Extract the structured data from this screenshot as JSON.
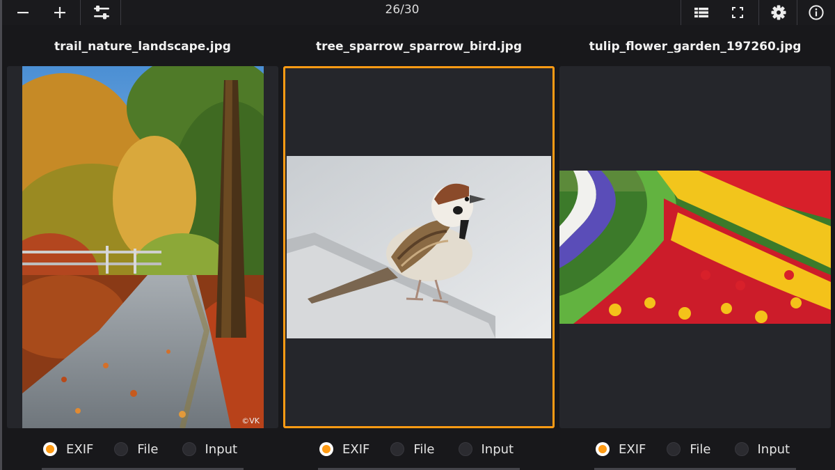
{
  "toolbar": {
    "counter": "26/30",
    "left_icons": [
      "minus-icon",
      "plus-icon",
      "sliders-icon"
    ],
    "right_icons": [
      "list-view-icon",
      "fullscreen-icon",
      "gear-icon",
      "info-icon"
    ]
  },
  "accent_color": "#ff9b14",
  "panels": [
    {
      "filename": "trail_nature_landscape.jpg",
      "watermark": "©VK",
      "selected": false,
      "radio": {
        "options": [
          "EXIF",
          "File",
          "Input"
        ],
        "selected": "EXIF"
      }
    },
    {
      "filename": "tree_sparrow_sparrow_bird.jpg",
      "selected": true,
      "radio": {
        "options": [
          "EXIF",
          "File",
          "Input"
        ],
        "selected": "EXIF"
      }
    },
    {
      "filename": "tulip_flower_garden_197260.jpg",
      "selected": false,
      "radio": {
        "options": [
          "EXIF",
          "File",
          "Input"
        ],
        "selected": "EXIF"
      }
    }
  ]
}
